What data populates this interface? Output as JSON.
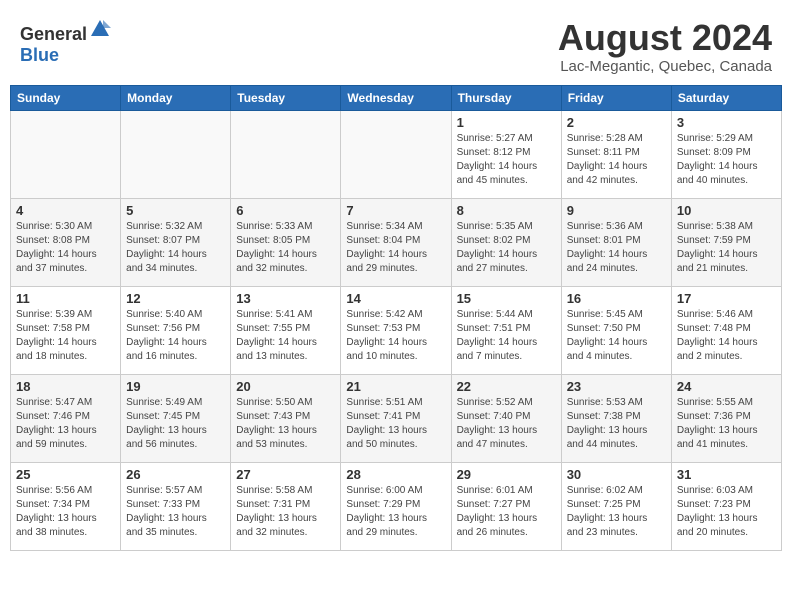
{
  "header": {
    "logo_general": "General",
    "logo_blue": "Blue",
    "month": "August 2024",
    "location": "Lac-Megantic, Quebec, Canada"
  },
  "weekdays": [
    "Sunday",
    "Monday",
    "Tuesday",
    "Wednesday",
    "Thursday",
    "Friday",
    "Saturday"
  ],
  "weeks": [
    [
      {
        "day": "",
        "info": ""
      },
      {
        "day": "",
        "info": ""
      },
      {
        "day": "",
        "info": ""
      },
      {
        "day": "",
        "info": ""
      },
      {
        "day": "1",
        "info": "Sunrise: 5:27 AM\nSunset: 8:12 PM\nDaylight: 14 hours\nand 45 minutes."
      },
      {
        "day": "2",
        "info": "Sunrise: 5:28 AM\nSunset: 8:11 PM\nDaylight: 14 hours\nand 42 minutes."
      },
      {
        "day": "3",
        "info": "Sunrise: 5:29 AM\nSunset: 8:09 PM\nDaylight: 14 hours\nand 40 minutes."
      }
    ],
    [
      {
        "day": "4",
        "info": "Sunrise: 5:30 AM\nSunset: 8:08 PM\nDaylight: 14 hours\nand 37 minutes."
      },
      {
        "day": "5",
        "info": "Sunrise: 5:32 AM\nSunset: 8:07 PM\nDaylight: 14 hours\nand 34 minutes."
      },
      {
        "day": "6",
        "info": "Sunrise: 5:33 AM\nSunset: 8:05 PM\nDaylight: 14 hours\nand 32 minutes."
      },
      {
        "day": "7",
        "info": "Sunrise: 5:34 AM\nSunset: 8:04 PM\nDaylight: 14 hours\nand 29 minutes."
      },
      {
        "day": "8",
        "info": "Sunrise: 5:35 AM\nSunset: 8:02 PM\nDaylight: 14 hours\nand 27 minutes."
      },
      {
        "day": "9",
        "info": "Sunrise: 5:36 AM\nSunset: 8:01 PM\nDaylight: 14 hours\nand 24 minutes."
      },
      {
        "day": "10",
        "info": "Sunrise: 5:38 AM\nSunset: 7:59 PM\nDaylight: 14 hours\nand 21 minutes."
      }
    ],
    [
      {
        "day": "11",
        "info": "Sunrise: 5:39 AM\nSunset: 7:58 PM\nDaylight: 14 hours\nand 18 minutes."
      },
      {
        "day": "12",
        "info": "Sunrise: 5:40 AM\nSunset: 7:56 PM\nDaylight: 14 hours\nand 16 minutes."
      },
      {
        "day": "13",
        "info": "Sunrise: 5:41 AM\nSunset: 7:55 PM\nDaylight: 14 hours\nand 13 minutes."
      },
      {
        "day": "14",
        "info": "Sunrise: 5:42 AM\nSunset: 7:53 PM\nDaylight: 14 hours\nand 10 minutes."
      },
      {
        "day": "15",
        "info": "Sunrise: 5:44 AM\nSunset: 7:51 PM\nDaylight: 14 hours\nand 7 minutes."
      },
      {
        "day": "16",
        "info": "Sunrise: 5:45 AM\nSunset: 7:50 PM\nDaylight: 14 hours\nand 4 minutes."
      },
      {
        "day": "17",
        "info": "Sunrise: 5:46 AM\nSunset: 7:48 PM\nDaylight: 14 hours\nand 2 minutes."
      }
    ],
    [
      {
        "day": "18",
        "info": "Sunrise: 5:47 AM\nSunset: 7:46 PM\nDaylight: 13 hours\nand 59 minutes."
      },
      {
        "day": "19",
        "info": "Sunrise: 5:49 AM\nSunset: 7:45 PM\nDaylight: 13 hours\nand 56 minutes."
      },
      {
        "day": "20",
        "info": "Sunrise: 5:50 AM\nSunset: 7:43 PM\nDaylight: 13 hours\nand 53 minutes."
      },
      {
        "day": "21",
        "info": "Sunrise: 5:51 AM\nSunset: 7:41 PM\nDaylight: 13 hours\nand 50 minutes."
      },
      {
        "day": "22",
        "info": "Sunrise: 5:52 AM\nSunset: 7:40 PM\nDaylight: 13 hours\nand 47 minutes."
      },
      {
        "day": "23",
        "info": "Sunrise: 5:53 AM\nSunset: 7:38 PM\nDaylight: 13 hours\nand 44 minutes."
      },
      {
        "day": "24",
        "info": "Sunrise: 5:55 AM\nSunset: 7:36 PM\nDaylight: 13 hours\nand 41 minutes."
      }
    ],
    [
      {
        "day": "25",
        "info": "Sunrise: 5:56 AM\nSunset: 7:34 PM\nDaylight: 13 hours\nand 38 minutes."
      },
      {
        "day": "26",
        "info": "Sunrise: 5:57 AM\nSunset: 7:33 PM\nDaylight: 13 hours\nand 35 minutes."
      },
      {
        "day": "27",
        "info": "Sunrise: 5:58 AM\nSunset: 7:31 PM\nDaylight: 13 hours\nand 32 minutes."
      },
      {
        "day": "28",
        "info": "Sunrise: 6:00 AM\nSunset: 7:29 PM\nDaylight: 13 hours\nand 29 minutes."
      },
      {
        "day": "29",
        "info": "Sunrise: 6:01 AM\nSunset: 7:27 PM\nDaylight: 13 hours\nand 26 minutes."
      },
      {
        "day": "30",
        "info": "Sunrise: 6:02 AM\nSunset: 7:25 PM\nDaylight: 13 hours\nand 23 minutes."
      },
      {
        "day": "31",
        "info": "Sunrise: 6:03 AM\nSunset: 7:23 PM\nDaylight: 13 hours\nand 20 minutes."
      }
    ]
  ]
}
